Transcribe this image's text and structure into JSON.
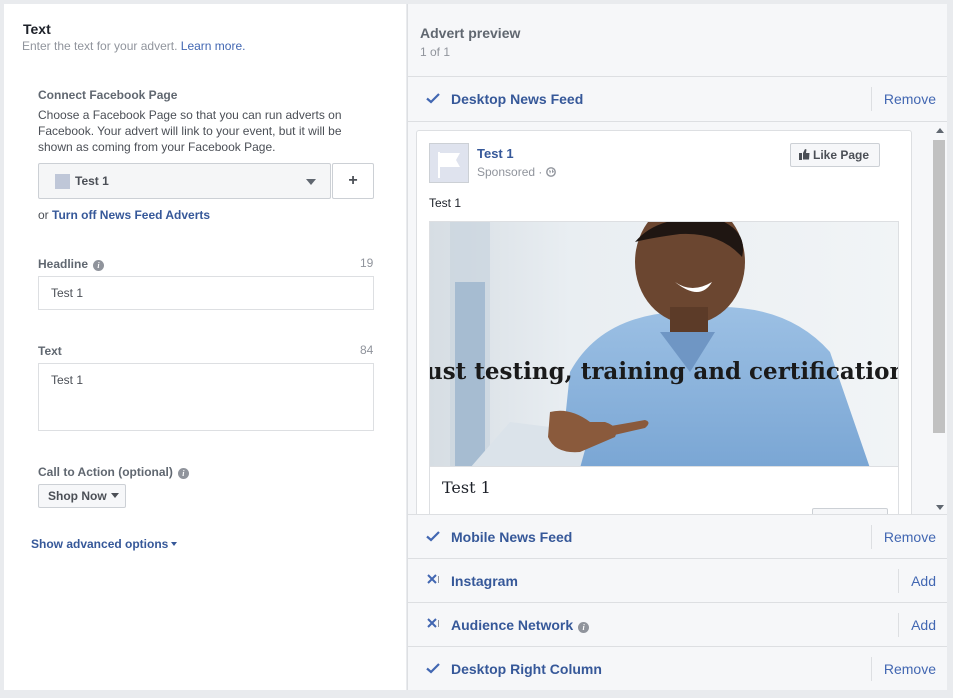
{
  "text_section": {
    "title": "Text",
    "subtitle": "Enter the text for your advert.",
    "learn_more": "Learn more."
  },
  "connect_page": {
    "label": "Connect Facebook Page",
    "description": "Choose a Facebook Page so that you can run adverts on Facebook. Your advert will link to your event, but it will be shown as coming from your Facebook Page.",
    "selected_page": "Test 1",
    "add_label": "+",
    "or_prefix": "or",
    "turn_off_link": "Turn off News Feed Adverts"
  },
  "headline": {
    "label": "Headline",
    "count": "19",
    "value": "Test 1"
  },
  "text_field": {
    "label": "Text",
    "count": "84",
    "value": "Test 1"
  },
  "cta": {
    "label": "Call to Action (optional)",
    "value": "Shop Now"
  },
  "advanced_options": "Show advanced options",
  "preview": {
    "title": "Advert preview",
    "count": "1 of 1",
    "placements": [
      {
        "name": "Desktop News Feed",
        "action": "Remove",
        "enabled": true,
        "info": false
      },
      {
        "name": "Mobile News Feed",
        "action": "Remove",
        "enabled": true,
        "info": false
      },
      {
        "name": "Instagram",
        "action": "Add",
        "enabled": false,
        "info": false
      },
      {
        "name": "Audience Network",
        "action": "Add",
        "enabled": false,
        "info": true
      },
      {
        "name": "Desktop Right Column",
        "action": "Remove",
        "enabled": true,
        "info": false
      }
    ],
    "post": {
      "page_name": "Test 1",
      "sponsored": "Sponsored · ",
      "like_button": "Like Page",
      "body_text": "Test 1",
      "image_overlay_text": "ust testing, training and certification plat",
      "caption": "Test 1"
    }
  },
  "colors": {
    "link_blue": "#365899",
    "accent_blue": "#4267b2",
    "panel_bg": "#f6f7f9",
    "border": "#dddfe2"
  }
}
